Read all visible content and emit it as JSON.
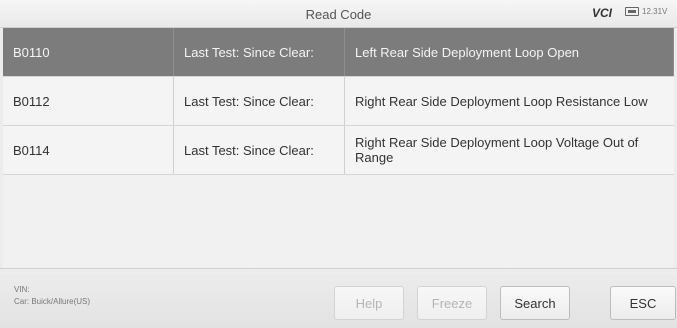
{
  "header": {
    "title": "Read Code",
    "vci_label": "VCI",
    "battery_label": "12.31V"
  },
  "rows": [
    {
      "code": "B0110",
      "status": "Last Test: Since Clear:",
      "description": "Left Rear Side Deployment Loop Open"
    },
    {
      "code": "B0112",
      "status": "Last Test: Since Clear:",
      "description": "Right Rear Side Deployment Loop Resistance Low"
    },
    {
      "code": "B0114",
      "status": "Last Test: Since Clear:",
      "description": "Right Rear Side Deployment Loop Voltage Out of Range"
    }
  ],
  "footer": {
    "vin_label": "VIN:",
    "car_label": "Car: Buick/Allure(US)",
    "buttons": {
      "help": "Help",
      "freeze": "Freeze",
      "search": "Search",
      "esc": "ESC"
    }
  },
  "icons": {
    "battery": "battery-icon"
  }
}
